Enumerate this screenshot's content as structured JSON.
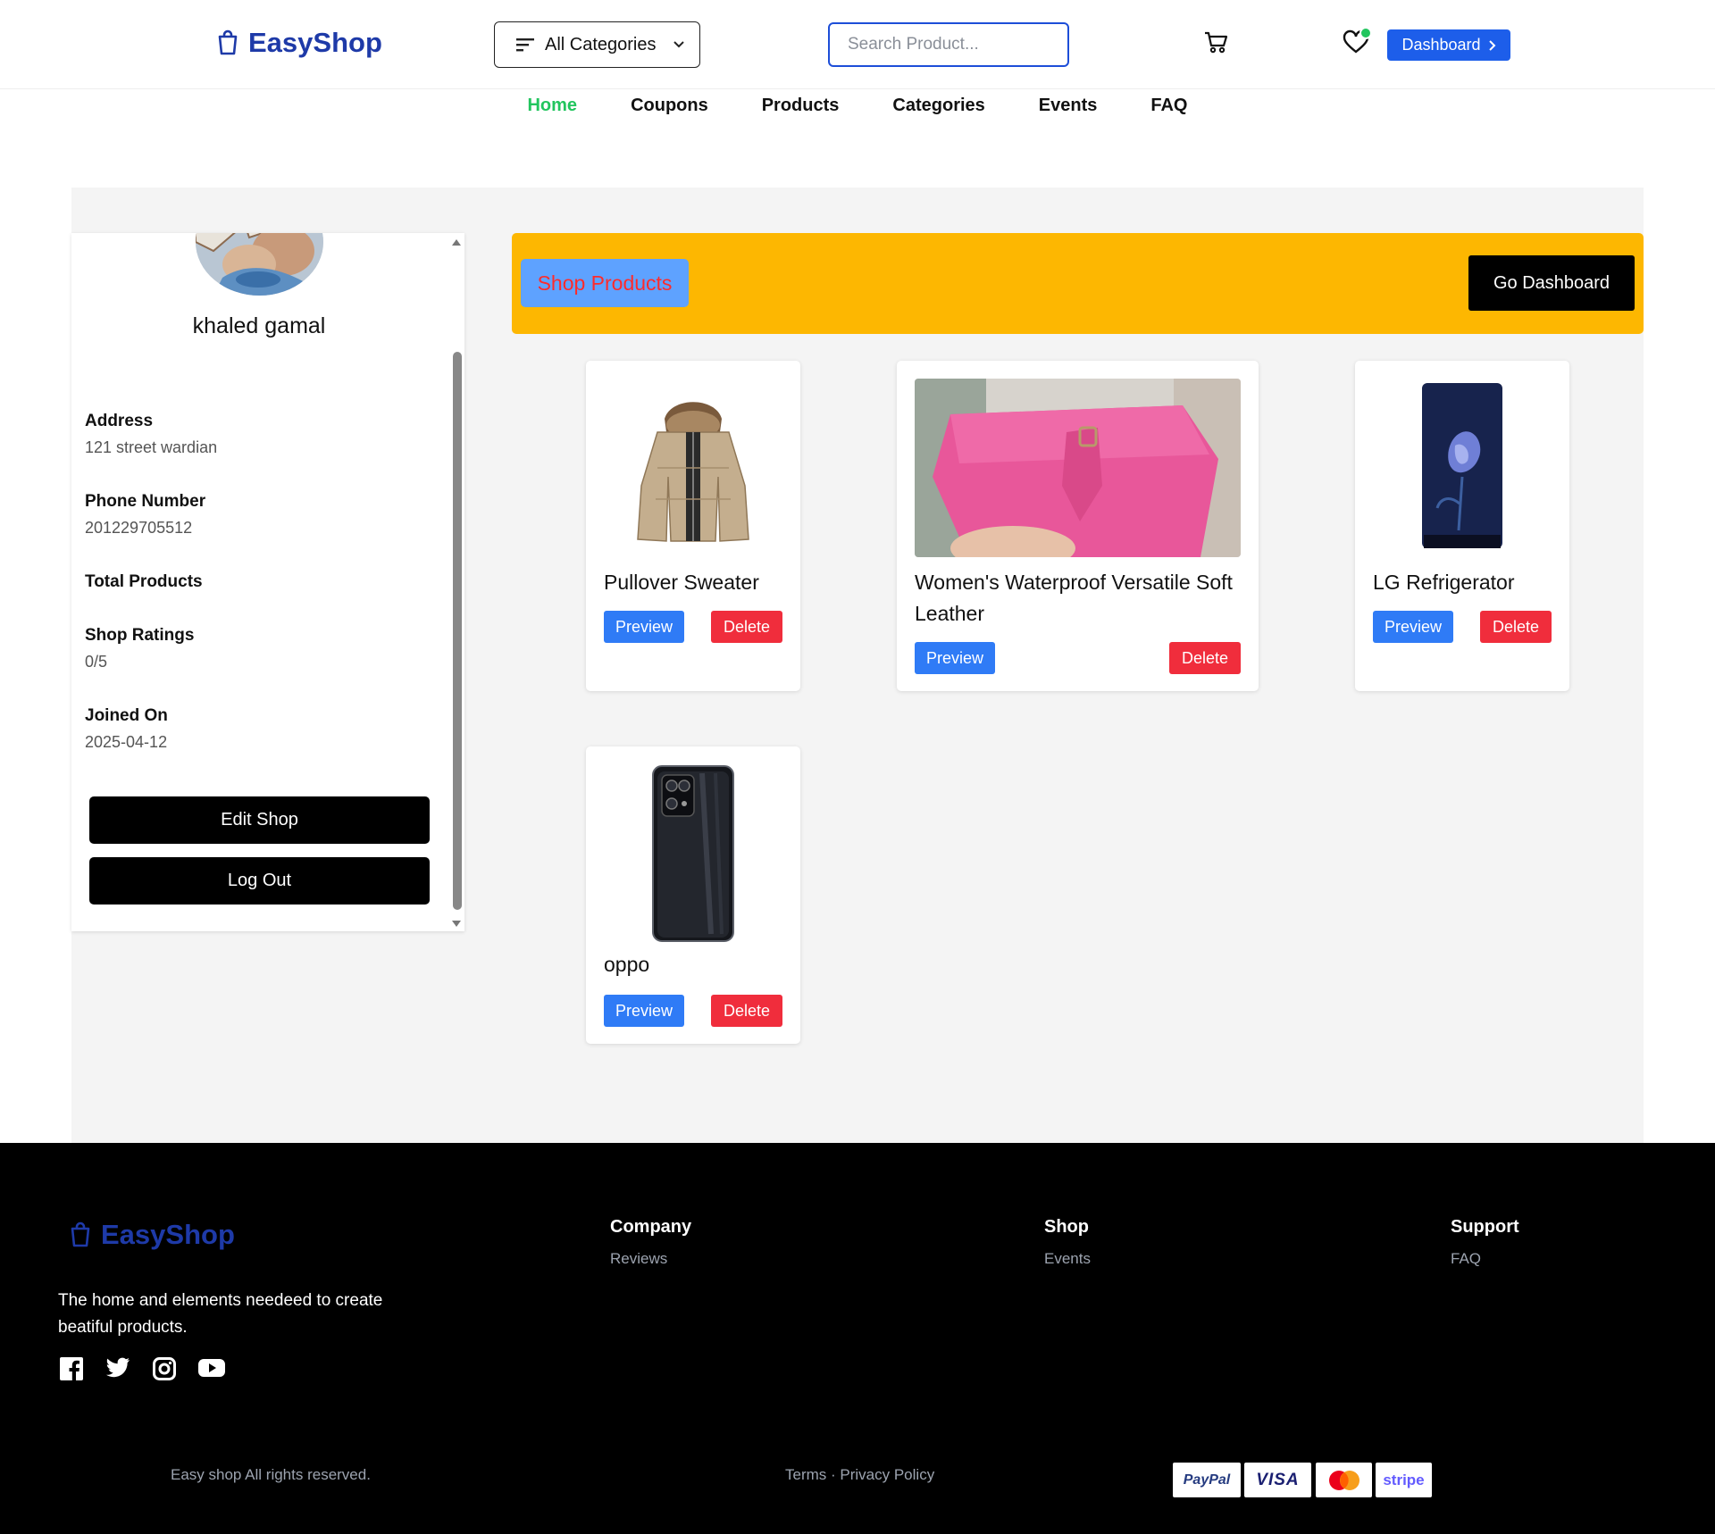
{
  "header": {
    "brand": "EasyShop",
    "categories_label": "All Categories",
    "search_placeholder": "Search Product...",
    "dashboard_label": "Dashboard",
    "accent_color": "#1d5eea"
  },
  "nav": {
    "items": [
      {
        "label": "Home",
        "active": true
      },
      {
        "label": "Coupons",
        "active": false
      },
      {
        "label": "Products",
        "active": false
      },
      {
        "label": "Categories",
        "active": false
      },
      {
        "label": "Events",
        "active": false
      },
      {
        "label": "FAQ",
        "active": false
      }
    ]
  },
  "profile": {
    "name": "khaled gamal",
    "address_label": "Address",
    "address": "121 street wardian",
    "phone_label": "Phone Number",
    "phone": "201229705512",
    "total_products_label": "Total Products",
    "ratings_label": "Shop Ratings",
    "ratings": "0/5",
    "joined_label": "Joined On",
    "joined": "2025-04-12",
    "edit_label": "Edit Shop",
    "logout_label": "Log Out"
  },
  "banner": {
    "shop_products_label": "Shop Products",
    "go_dashboard_label": "Go Dashboard",
    "color": "#fdb701"
  },
  "products": [
    {
      "title": "Pullover Sweater",
      "image": "jacket"
    },
    {
      "title": "Women's Waterproof Versatile Soft Leather",
      "image": "pink-wallet"
    },
    {
      "title": "LG Refrigerator",
      "image": "refrigerator"
    },
    {
      "title": "oppo",
      "image": "phone"
    }
  ],
  "product_actions": {
    "preview": "Preview",
    "delete": "Delete"
  },
  "footer": {
    "brand": "EasyShop",
    "tagline": "The home and elements needeed to create beatiful products.",
    "social": [
      "facebook-icon",
      "twitter-icon",
      "instagram-icon",
      "youtube-icon"
    ],
    "company": {
      "heading": "Company",
      "links": [
        "Reviews"
      ]
    },
    "shop": {
      "heading": "Shop",
      "links": [
        "Events"
      ]
    },
    "support": {
      "heading": "Support",
      "links": [
        "FAQ"
      ]
    },
    "copyright": "Easy shop All rights reserved.",
    "terms": "Terms",
    "separator": " · ",
    "privacy": "Privacy Policy",
    "payments": [
      "PayPal",
      "VISA",
      "mastercard",
      "stripe"
    ]
  }
}
